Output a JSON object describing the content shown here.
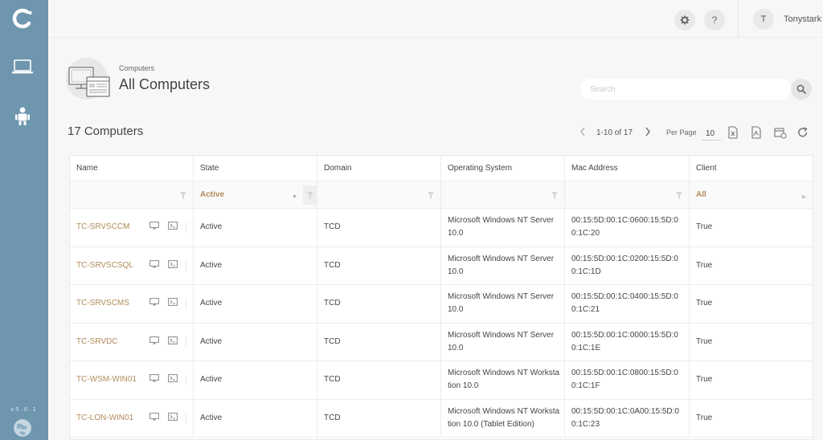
{
  "sidebar": {
    "version": "v5.0.1",
    "items": [
      {
        "name": "computers",
        "icon": "laptop-icon"
      },
      {
        "name": "users",
        "icon": "user-robot-icon"
      }
    ]
  },
  "topbar": {
    "settings_icon": "gear-icon",
    "help_label": "?",
    "avatar_initial": "T",
    "username": "Tonystark"
  },
  "header": {
    "breadcrumb": "Computers",
    "title": "All Computers",
    "search_placeholder": "Search"
  },
  "list": {
    "count_label": "17 Computers",
    "pager_range": "1-10 of 17",
    "per_page_label": "Per Page",
    "per_page_value": "10"
  },
  "table": {
    "columns": [
      "Name",
      "State",
      "Domain",
      "Operating System",
      "Mac Address",
      "Client"
    ],
    "filters": {
      "state": "Active",
      "client": "All"
    },
    "rows": [
      {
        "name": "TC-SRVSCCM",
        "state": "Active",
        "domain": "TCD",
        "os": "Microsoft Windows NT Server 10.0",
        "mac": "00:15:5D:00:1C:0600:15:5D:00:1C:20",
        "client": "True"
      },
      {
        "name": "TC-SRVSCSQL",
        "state": "Active",
        "domain": "TCD",
        "os": "Microsoft Windows NT Server 10.0",
        "mac": "00:15:5D:00:1C:0200:15:5D:00:1C:1D",
        "client": "True"
      },
      {
        "name": "TC-SRVSCMS",
        "state": "Active",
        "domain": "TCD",
        "os": "Microsoft Windows NT Server 10.0",
        "mac": "00:15:5D:00:1C:0400:15:5D:00:1C:21",
        "client": "True"
      },
      {
        "name": "TC-SRVDC",
        "state": "Active",
        "domain": "TCD",
        "os": "Microsoft Windows NT Server 10.0",
        "mac": "00:15:5D:00:1C:0000:15:5D:00:1C:1E",
        "client": "True"
      },
      {
        "name": "TC-WSM-WIN01",
        "state": "Active",
        "domain": "TCD",
        "os": "Microsoft Windows NT Workstation 10.0",
        "mac": "00:15:5D:00:1C:0800:15:5D:00:1C:1F",
        "client": "True"
      },
      {
        "name": "TC-LON-WIN01",
        "state": "Active",
        "domain": "TCD",
        "os": "Microsoft Windows NT Workstation 10.0 (Tablet Edition)",
        "mac": "00:15:5D:00:1C:0A00:15:5D:00:1C:23",
        "client": "True"
      }
    ]
  },
  "colors": {
    "sidebar": "#6e96ae",
    "accent": "#b08a5a",
    "background": "#f7f7f7"
  }
}
